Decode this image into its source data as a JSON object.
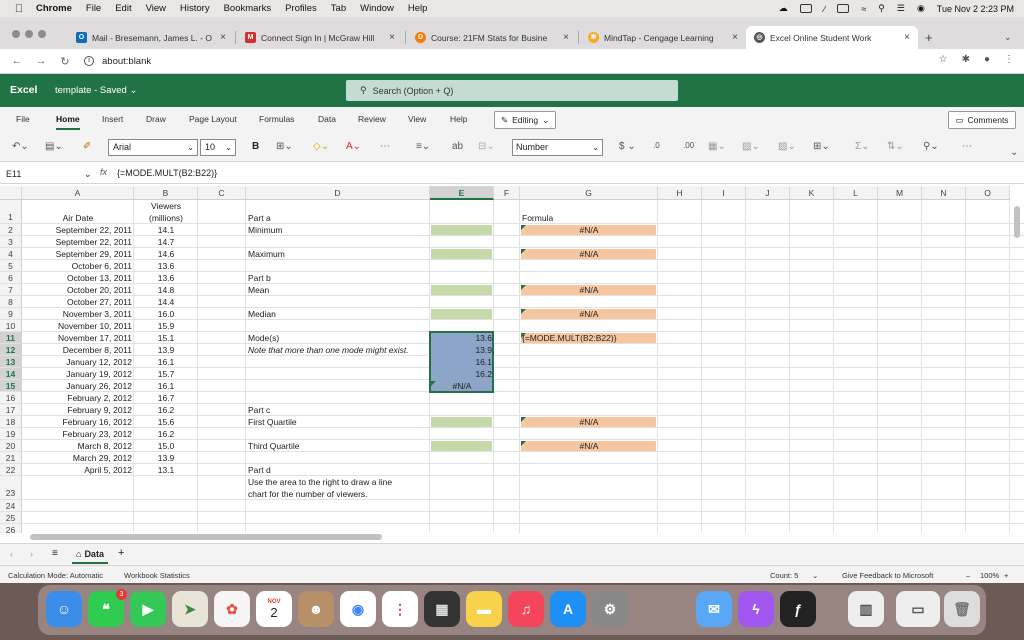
{
  "os_menubar": {
    "app": "Chrome",
    "items": [
      "File",
      "Edit",
      "View",
      "History",
      "Bookmarks",
      "Profiles",
      "Tab",
      "Window",
      "Help"
    ],
    "datetime": "Tue Nov 2  2:23 PM"
  },
  "browser": {
    "tabs": [
      {
        "label": "Mail - Bresemann, James L. - O",
        "favicon": "outlook-icon",
        "color": "#0f6cbd"
      },
      {
        "label": "Connect Sign In | McGraw Hill",
        "favicon": "mcgraw-icon",
        "color": "#d32f2f"
      },
      {
        "label": "Course: 21FM Stats for Busine",
        "favicon": "course-icon",
        "color": "#f57c00"
      },
      {
        "label": "MindTap - Cengage Learning",
        "favicon": "mindtap-icon",
        "color": "#f9a825"
      },
      {
        "label": "Excel Online Student Work",
        "favicon": "excel-globe-icon",
        "color": "#555555"
      }
    ],
    "url": "about:blank"
  },
  "excel": {
    "app_name": "Excel",
    "doc_title": "template - Saved ⌄",
    "search_placeholder": "Search (Option + Q)",
    "ribbon_tabs": [
      "File",
      "Home",
      "Insert",
      "Draw",
      "Page Layout",
      "Formulas",
      "Data",
      "Review",
      "View",
      "Help"
    ],
    "editing_label": "Editing",
    "comments_label": "Comments",
    "font_name": "Arial",
    "font_size": "10",
    "number_format": "Number",
    "name_box": "E11",
    "fx_label": "fx",
    "formula": "{=MODE.MULT(B2:B22)}",
    "columns": [
      "A",
      "B",
      "C",
      "D",
      "E",
      "F",
      "G",
      "H",
      "I",
      "J",
      "K",
      "L",
      "M",
      "N",
      "O"
    ],
    "rows": [
      "1",
      "2",
      "3",
      "4",
      "5",
      "6",
      "7",
      "8",
      "9",
      "10",
      "11",
      "12",
      "13",
      "14",
      "15",
      "16",
      "17",
      "18",
      "19",
      "20",
      "21",
      "22",
      "23",
      "24",
      "25",
      "26"
    ],
    "header_air_date": "Air Date",
    "header_viewers_1": "Viewers",
    "header_viewers_2": "(millions)",
    "data_rows": [
      {
        "date": "September 22, 2011",
        "viewers": "14.1"
      },
      {
        "date": "September 22, 2011",
        "viewers": "14.7"
      },
      {
        "date": "September 29, 2011",
        "viewers": "14.6"
      },
      {
        "date": "October 6, 2011",
        "viewers": "13.6"
      },
      {
        "date": "October 13, 2011",
        "viewers": "13.6"
      },
      {
        "date": "October 20, 2011",
        "viewers": "14.8"
      },
      {
        "date": "October 27, 2011",
        "viewers": "14.4"
      },
      {
        "date": "November 3, 2011",
        "viewers": "16.0"
      },
      {
        "date": "November 10, 2011",
        "viewers": "15.9"
      },
      {
        "date": "November 17, 2011",
        "viewers": "15.1"
      },
      {
        "date": "December 8, 2011",
        "viewers": "13.9"
      },
      {
        "date": "January 12, 2012",
        "viewers": "16.1"
      },
      {
        "date": "January 19, 2012",
        "viewers": "15.7"
      },
      {
        "date": "January 26, 2012",
        "viewers": "16.1"
      },
      {
        "date": "February 2, 2012",
        "viewers": "16.7"
      },
      {
        "date": "February 9, 2012",
        "viewers": "16.2"
      },
      {
        "date": "February 16, 2012",
        "viewers": "15.6"
      },
      {
        "date": "February 23, 2012",
        "viewers": "16.2"
      },
      {
        "date": "March 8, 2012",
        "viewers": "15.0"
      },
      {
        "date": "March 29, 2012",
        "viewers": "13.9"
      },
      {
        "date": "April 5, 2012",
        "viewers": "13.1"
      }
    ],
    "labels": {
      "part_a": "Part a",
      "minimum": "Minimum",
      "maximum": "Maximum",
      "part_b": "Part b",
      "mean": "Mean",
      "median": "Median",
      "modes": "Mode(s)",
      "mode_note": "Note that more than one mode might exist.",
      "part_c": "Part c",
      "first_quartile": "First Quartile",
      "third_quartile": "Third Quartile",
      "part_d": "Part d",
      "part_d_line1": "Use the area to the right to draw a line",
      "part_d_line2": "chart for the number of viewers.",
      "formula_header": "Formula"
    },
    "na_value": "#N/A",
    "mode_formula": "{=MODE.MULT(B2:B22)}",
    "mode_results": [
      "13.6",
      "13.9",
      "16.1",
      "16.2",
      "#N/A"
    ],
    "sheet_tab": "Data",
    "status": {
      "calc_mode": "Calculation Mode: Automatic",
      "workbook_stats": "Workbook Statistics",
      "count": "Count: 5",
      "feedback": "Give Feedback to Microsoft",
      "zoom": "100%"
    },
    "colors": {
      "brand": "#217346",
      "green_fill": "#c6d9a8",
      "orange_fill": "#f6c6a0",
      "selection": "#8da5c9"
    }
  },
  "dock": {
    "calendar_month": "NOV",
    "calendar_day": "2",
    "messages_badge": "3"
  }
}
